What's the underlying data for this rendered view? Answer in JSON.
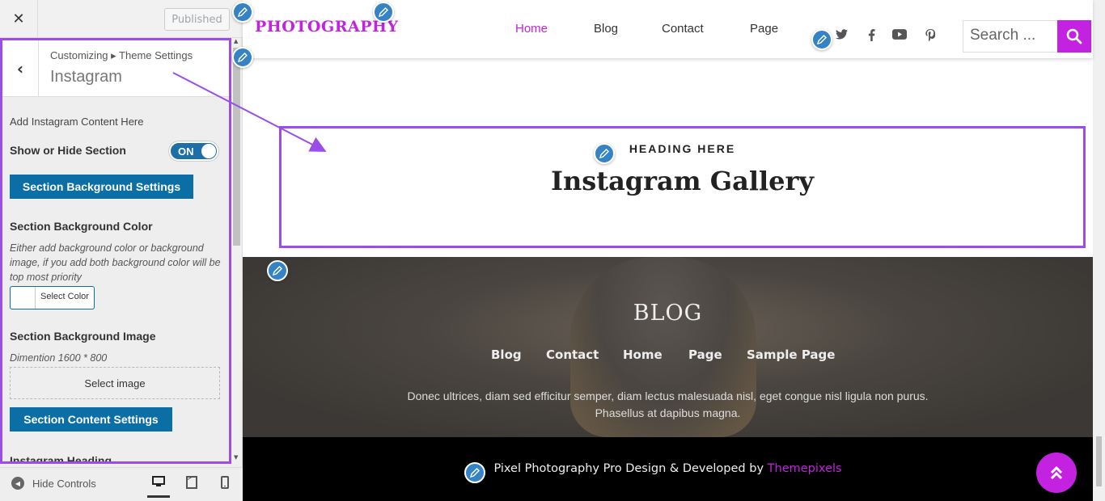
{
  "customizer": {
    "close_icon": "close-icon",
    "publish_label": "Published",
    "breadcrumb": "Customizing ▸ Theme Settings",
    "panel_title": "Instagram",
    "description": "Add Instagram Content Here",
    "show_hide_label": "Show or Hide Section",
    "toggle_state": "ON",
    "bg_settings_button": "Section Background Settings",
    "bg_color_label": "Section Background Color",
    "bg_color_help": "Either add background color or background image, if you add both background color will be top most priority",
    "select_color_label": "Select Color",
    "bg_image_label": "Section Background Image",
    "bg_image_dimension": "Dimention 1600 * 800",
    "select_image_label": "Select image",
    "content_settings_button": "Section Content Settings",
    "instagram_heading_label": "Instagram Heading",
    "hide_controls_label": "Hide Controls"
  },
  "site": {
    "logo": "PHOTOGRAPHY",
    "nav": [
      {
        "label": "Home",
        "active": true
      },
      {
        "label": "Blog",
        "active": false
      },
      {
        "label": "Contact",
        "active": false
      },
      {
        "label": "Page",
        "active": false
      }
    ],
    "social_icons": [
      "twitter-icon",
      "facebook-icon",
      "youtube-icon",
      "pinterest-icon"
    ],
    "search_placeholder": "Search ...",
    "instagram": {
      "heading_small": "HEADING HERE",
      "heading": "Instagram Gallery"
    },
    "blog": {
      "title": "BLOG",
      "links": [
        "Blog",
        "Contact",
        "Home",
        "Page",
        "Sample Page"
      ],
      "text": "Donec ultrices, diam sed efficitur semper, diam lectus malesuada nisl, eget congue nisl ligula non purus. Phasellus at dapibus magna."
    },
    "copyright_prefix": "Pixel Photography Pro Design & Developed by ",
    "copyright_link": "Themepixels"
  },
  "colors": {
    "accent": "#c322e0",
    "highlight": "#9b4dea",
    "wp_blue": "#0b6fa5"
  }
}
